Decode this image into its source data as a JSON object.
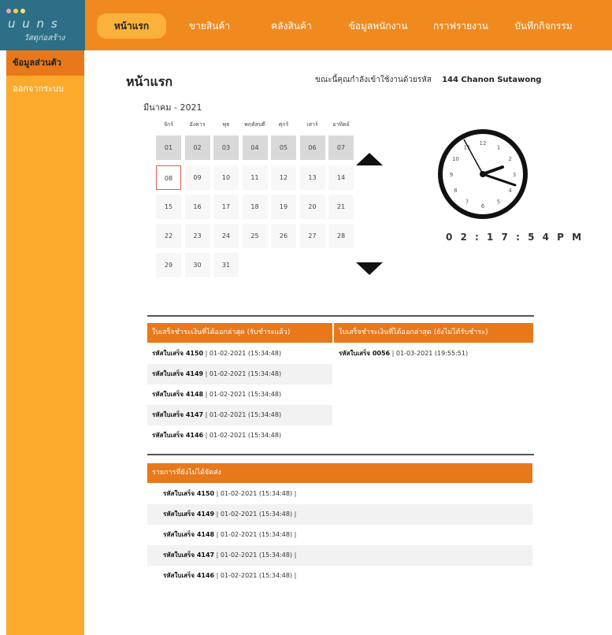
{
  "brand": {
    "title": "u u n s",
    "subtitle": "วัสดุก่อสร้าง",
    "dot_colors": [
      "#e8a6b6",
      "#f3d24e",
      "#ffe36a"
    ]
  },
  "nav": {
    "items": [
      {
        "label": "หน้าแรก",
        "active": true
      },
      {
        "label": "ขายสินค้า",
        "active": false
      },
      {
        "label": "คลังสินค้า",
        "active": false
      },
      {
        "label": "ข้อมูลพนักงาน",
        "active": false
      },
      {
        "label": "กราฟรายงาน",
        "active": false
      },
      {
        "label": "บันทึกกิจกรรม",
        "active": false
      }
    ]
  },
  "sidebar": {
    "items": [
      {
        "label": "ข้อมูลส่วนตัว",
        "active": true
      },
      {
        "label": "ออกจากระบบ",
        "active": false
      }
    ]
  },
  "page": {
    "title": "หน้าแรก",
    "login_prefix": "ขณะนี้คุณกำลังเข้าใช้งานด้วยรหัส",
    "login_user": "144 Chanon Sutawong"
  },
  "calendar": {
    "month_label": "มีนาคม - 2021",
    "weekdays": [
      "จักร์",
      "อังคาร",
      "พุธ",
      "พฤหัสบดี",
      "ศุกร์",
      "เสาร์",
      "อาทิตย์"
    ],
    "days": [
      [
        "01",
        "02",
        "03",
        "04",
        "05",
        "06",
        "07"
      ],
      [
        "08",
        "09",
        "10",
        "11",
        "12",
        "13",
        "14"
      ],
      [
        "15",
        "16",
        "17",
        "18",
        "19",
        "20",
        "21"
      ],
      [
        "22",
        "23",
        "24",
        "25",
        "26",
        "27",
        "28"
      ],
      [
        "29",
        "30",
        "31"
      ]
    ],
    "today": "08"
  },
  "clock": {
    "time_text": "0 2 : 1 7 : 5 4   P M",
    "numbers": [
      "12",
      "1",
      "2",
      "3",
      "4",
      "5",
      "6",
      "7",
      "8",
      "9",
      "10",
      "11"
    ]
  },
  "receipts_paid": {
    "header": "ใบเสร็จชำระเงินที่ได้ออกล่าสุด (รับชำระแล้ว)",
    "rows": [
      {
        "code": "รหัสใบเสร็จ 4150",
        "detail": " | 01-02-2021 (15:34:48)"
      },
      {
        "code": "รหัสใบเสร็จ 4149",
        "detail": " | 01-02-2021 (15:34:48)"
      },
      {
        "code": "รหัสใบเสร็จ 4148",
        "detail": " | 01-02-2021 (15:34:48)"
      },
      {
        "code": "รหัสใบเสร็จ 4147",
        "detail": " | 01-02-2021 (15:34:48)"
      },
      {
        "code": "รหัสใบเสร็จ 4146",
        "detail": " | 01-02-2021 (15:34:48)"
      }
    ]
  },
  "receipts_unpaid": {
    "header": "ใบเสร็จชำระเงินที่ได้ออกล่าสุด (ยังไม่ได้รับชำระ)",
    "rows": [
      {
        "code": "รหัสใบเสร็จ 0056",
        "detail": " | 01-03-2021 (19:55:51)"
      }
    ]
  },
  "pending_delivery": {
    "header": "รายการที่ยังไม่ได้จัดส่ง",
    "rows": [
      {
        "code": "รหัสใบเสร็จ 4150",
        "detail": " | 01-02-2021 (15:34:48) |"
      },
      {
        "code": "รหัสใบเสร็จ 4149",
        "detail": " | 01-02-2021 (15:34:48) |"
      },
      {
        "code": "รหัสใบเสร็จ 4148",
        "detail": " | 01-02-2021 (15:34:48) |"
      },
      {
        "code": "รหัสใบเสร็จ 4147",
        "detail": " | 01-02-2021 (15:34:48) |"
      },
      {
        "code": "รหัสใบเสร็จ 4146",
        "detail": " | 01-02-2021 (15:34:48) |"
      }
    ]
  }
}
